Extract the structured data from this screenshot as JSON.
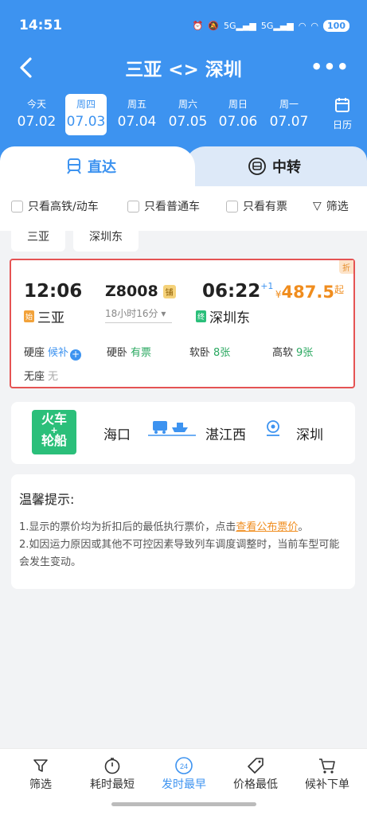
{
  "status": {
    "time": "14:51",
    "network1": "5G",
    "network2": "5G",
    "battery": "100"
  },
  "nav": {
    "title": "三亚 <> 深圳"
  },
  "dates": [
    {
      "weekday": "今天",
      "date": "07.02"
    },
    {
      "weekday": "周四",
      "date": "07.03"
    },
    {
      "weekday": "周五",
      "date": "07.04"
    },
    {
      "weekday": "周六",
      "date": "07.05"
    },
    {
      "weekday": "周日",
      "date": "07.06"
    },
    {
      "weekday": "周一",
      "date": "07.07"
    }
  ],
  "calendar_label": "日历",
  "tabs": {
    "direct": "直达",
    "transfer": "中转"
  },
  "filters": {
    "high_speed": "只看高铁/动车",
    "normal": "只看普通车",
    "available": "只看有票",
    "filter": "筛选"
  },
  "stations": [
    "三亚",
    "深圳东"
  ],
  "train": {
    "dep_time": "12:06",
    "dep_station": "三亚",
    "dep_tag": "始",
    "number": "Z8008",
    "badge": "铺",
    "duration": "18小时16分",
    "arr_time": "06:22",
    "arr_day": "+1",
    "arr_station": "深圳东",
    "arr_tag": "终",
    "price_currency": "¥",
    "price": "487.5",
    "price_suffix": "起",
    "discount": "折",
    "seats": [
      {
        "type": "硬座",
        "status": "候补"
      },
      {
        "type": "硬卧",
        "status": "有票"
      },
      {
        "type": "软卧",
        "status": "8张"
      },
      {
        "type": "高软",
        "status": "9张"
      },
      {
        "type": "无座",
        "status": "无"
      }
    ]
  },
  "transfer_card": {
    "logo_line1": "火车",
    "logo_plus": "+",
    "logo_line2": "轮船",
    "from": "海口",
    "via": "湛江西",
    "to": "深圳"
  },
  "tips": {
    "title": "温馨提示:",
    "line1_prefix": "1.显示的票价均为折扣后的最低执行票价，点击",
    "line1_link": "查看公布票价",
    "line1_suffix": "。",
    "line2": "2.如因运力原因或其他不可控因素导致列车调度调整时，当前车型可能会发生变动。"
  },
  "bottom": [
    {
      "label": "筛选"
    },
    {
      "label": "耗时最短"
    },
    {
      "label": "发时最早",
      "badge": "24"
    },
    {
      "label": "价格最低"
    },
    {
      "label": "候补下单"
    }
  ],
  "colors": {
    "primary": "#3d93f0",
    "price": "#f08d1e",
    "available": "#2aa860",
    "highlight_border": "#e55353"
  }
}
